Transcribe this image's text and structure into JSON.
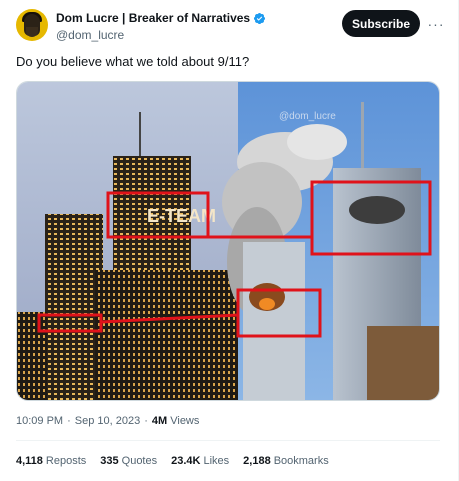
{
  "author": {
    "display_name": "Dom Lucre | Breaker of Narratives",
    "handle": "@dom_lucre",
    "verified": true
  },
  "actions": {
    "subscribe_label": "Subscribe",
    "more_icon": "more-horizontal-icon",
    "more_glyph": "···"
  },
  "tweet": {
    "text": "Do you believe what we told about 9/11?"
  },
  "media": {
    "watermark": "@dom_lucre",
    "sign_text": "E-TEAM",
    "highlight_color": "#e0121a"
  },
  "meta": {
    "time": "10:09 PM",
    "separator_1": "·",
    "date": "Sep 10, 2023",
    "separator_2": "·",
    "views_count": "4M",
    "views_label": "Views"
  },
  "stats": {
    "reposts": {
      "count": "4,118",
      "label": "Reposts"
    },
    "quotes": {
      "count": "335",
      "label": "Quotes"
    },
    "likes": {
      "count": "23.4K",
      "label": "Likes"
    },
    "bookmarks": {
      "count": "2,188",
      "label": "Bookmarks"
    }
  },
  "colors": {
    "text_primary": "#0f1419",
    "text_secondary": "#536471",
    "verified_blue": "#1d9bf0",
    "button_dark": "#0f1419"
  }
}
